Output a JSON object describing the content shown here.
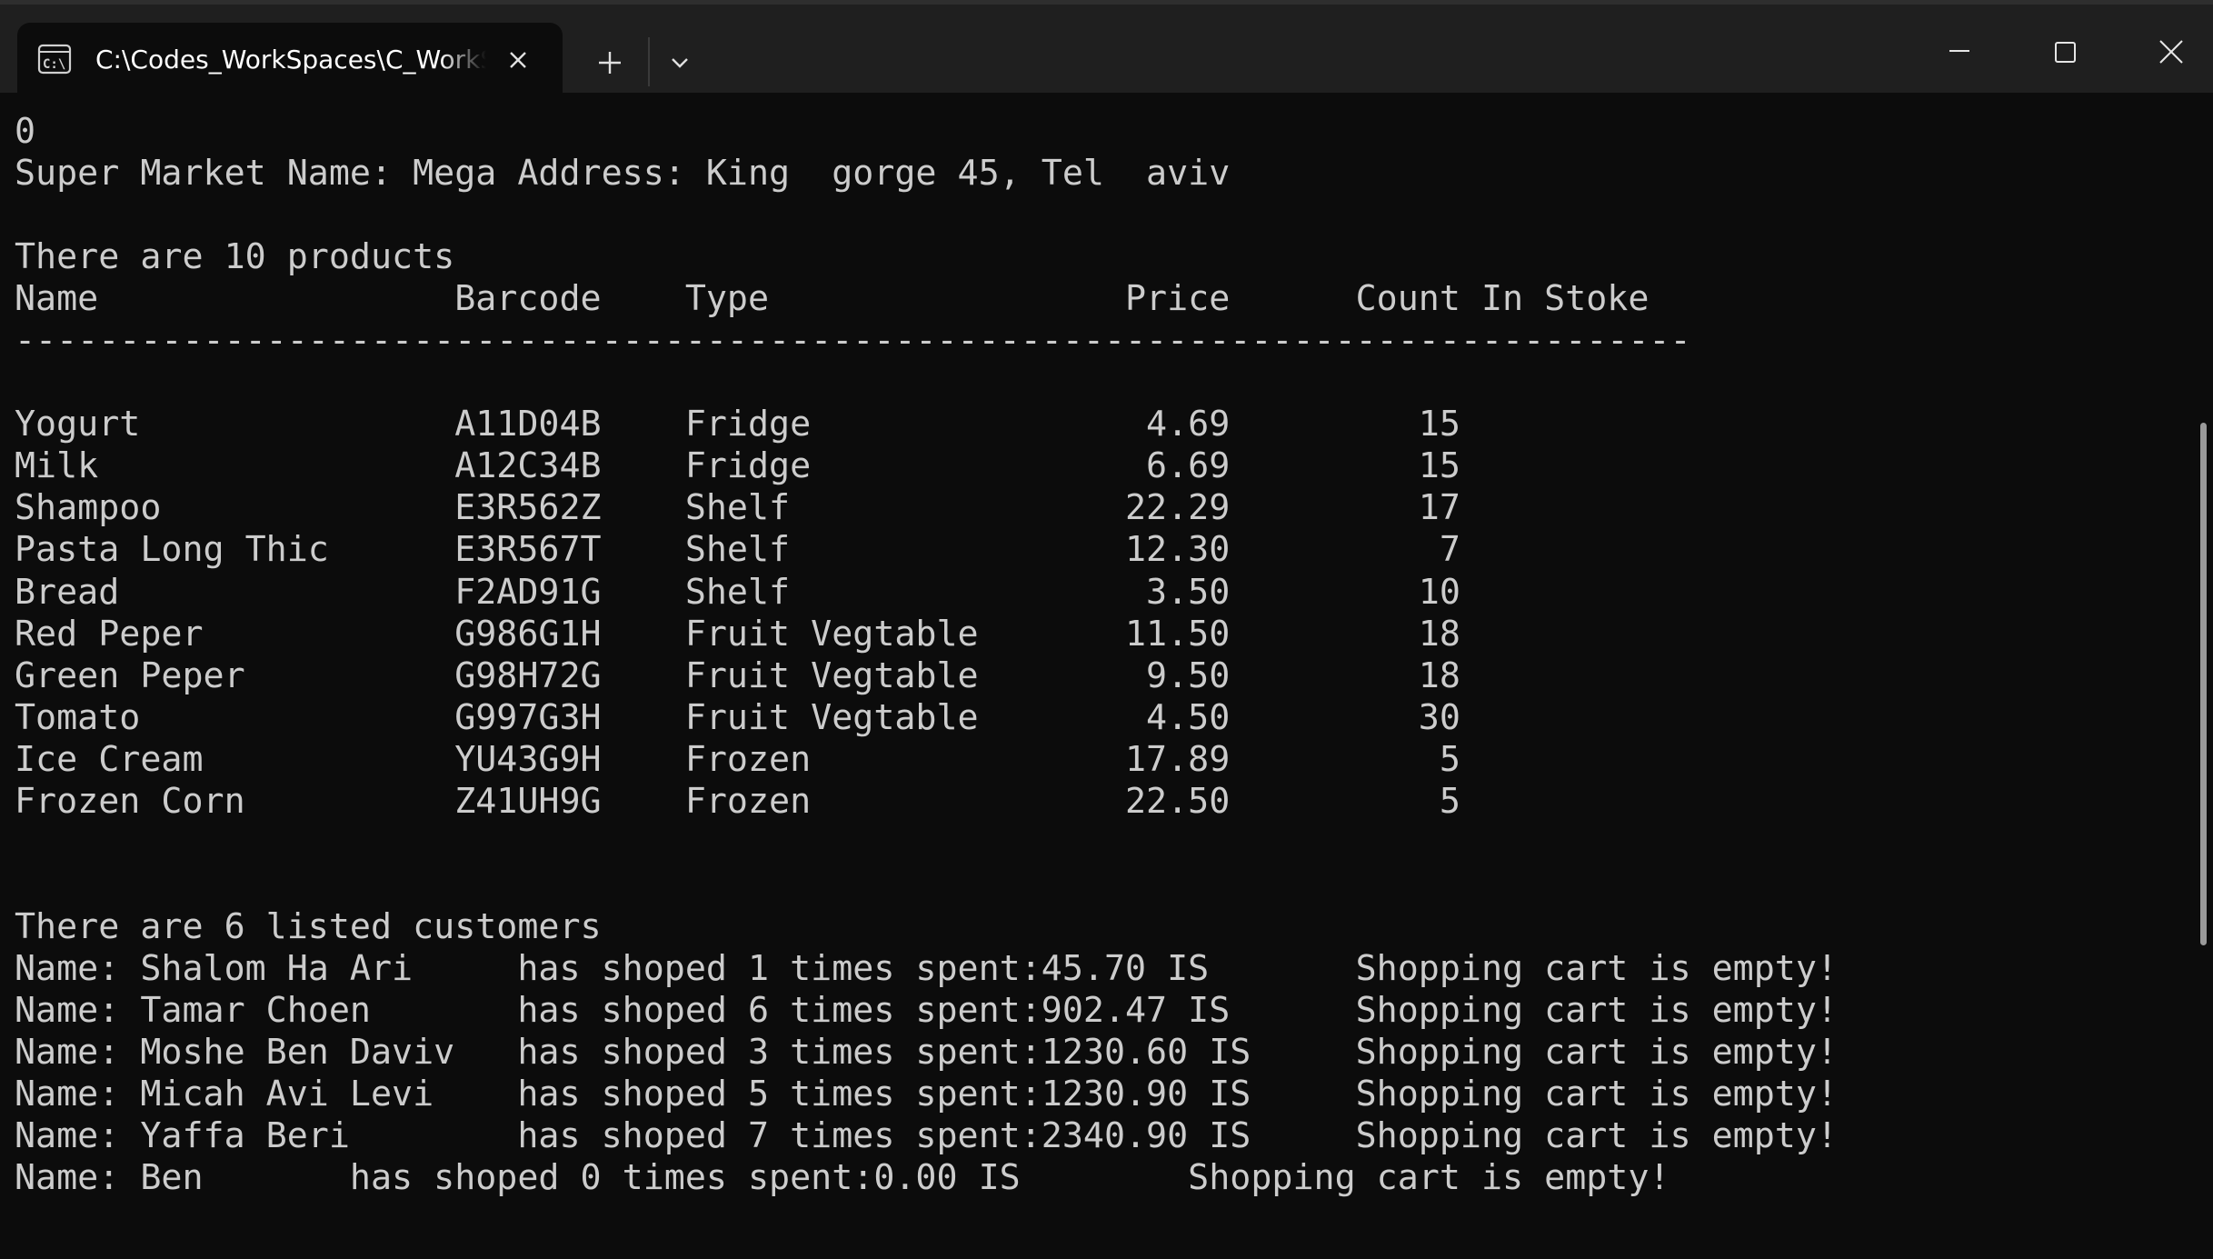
{
  "titlebar": {
    "tab_title": "C:\\Codes_WorkSpaces\\C_WorkSpace",
    "tab_icon": "terminal-icon",
    "new_tab_icon": "plus-icon",
    "dropdown_icon": "chevron-down-icon",
    "minimize_icon": "minimize-icon",
    "maximize_icon": "maximize-icon",
    "close_icon": "close-icon"
  },
  "console": {
    "lines": [
      "0",
      "Super Market Name: Mega Address: King  gorge 45, Tel  aviv",
      "",
      "There are 10 products",
      "Name                 Barcode    Type                 Price      Count In Stoke",
      "--------------------------------------------------------------------------------",
      "",
      "Yogurt               A11D04B    Fridge                4.69         15",
      "Milk                 A12C34B    Fridge                6.69         15",
      "Shampoo              E3R562Z    Shelf                22.29         17",
      "Pasta Long Thic      E3R567T    Shelf                12.30          7",
      "Bread                F2AD91G    Shelf                 3.50         10",
      "Red Peper            G986G1H    Fruit Vegtable       11.50         18",
      "Green Peper          G98H72G    Fruit Vegtable        9.50         18",
      "Tomato               G997G3H    Fruit Vegtable        4.50         30",
      "Ice Cream            YU43G9H    Frozen               17.89          5",
      "Frozen Corn          Z41UH9G    Frozen               22.50          5",
      "",
      "",
      "There are 6 listed customers",
      "Name: Shalom Ha Ari     has shoped 1 times spent:45.70 IS       Shopping cart is empty!",
      "Name: Tamar Choen       has shoped 6 times spent:902.47 IS      Shopping cart is empty!",
      "Name: Moshe Ben Daviv   has shoped 3 times spent:1230.60 IS     Shopping cart is empty!",
      "Name: Micah Avi Levi    has shoped 5 times spent:1230.90 IS     Shopping cart is empty!",
      "Name: Yaffa Beri        has shoped 7 times spent:2340.90 IS     Shopping cart is empty!",
      "Name: Ben       has shoped 0 times spent:0.00 IS        Shopping cart is empty!"
    ]
  },
  "colors": {
    "background": "#0c0c0c",
    "titlebar": "#1f1f1f",
    "text": "#cccccc"
  }
}
